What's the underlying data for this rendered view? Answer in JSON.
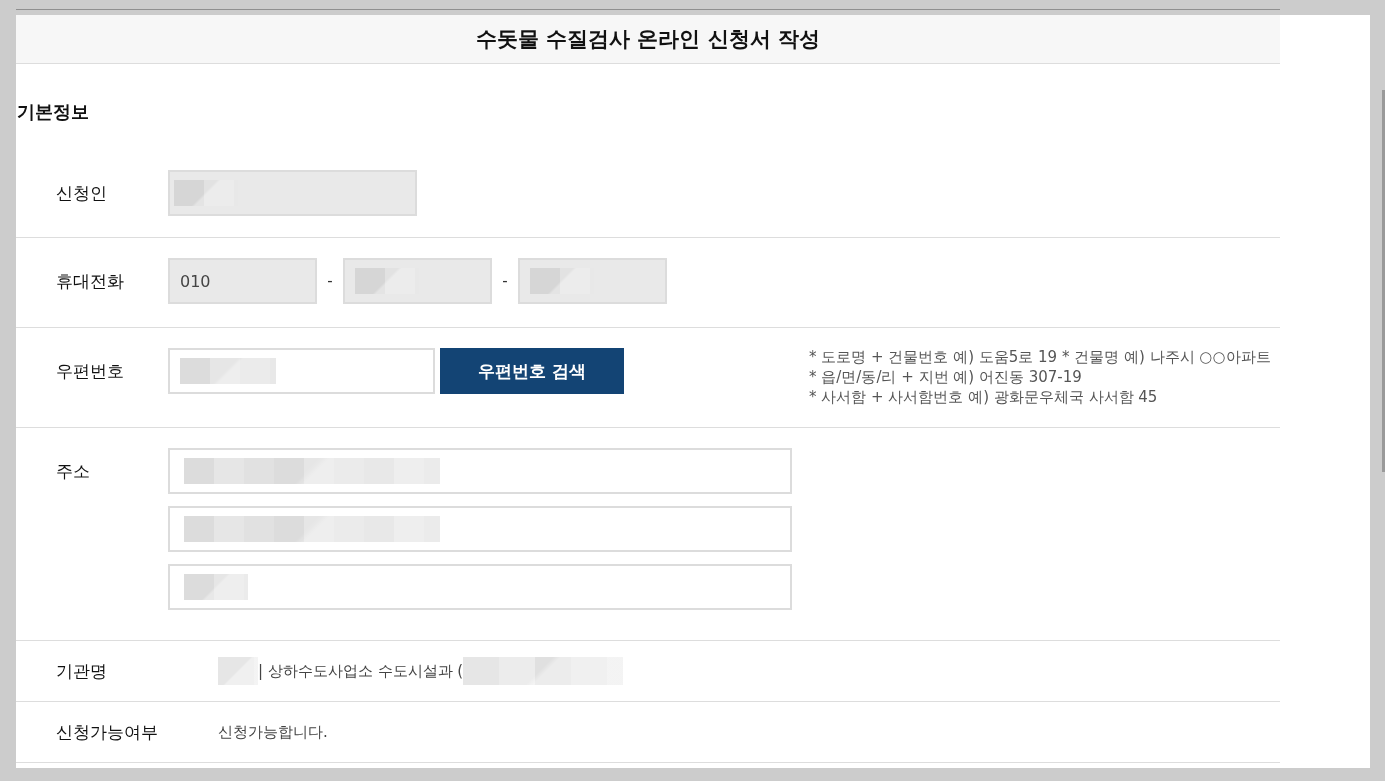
{
  "title": "수돗물 수질검사 온라인 신청서 작성",
  "section": {
    "heading": "기본정보",
    "rows": [
      {
        "kind": "single",
        "label": "신청인",
        "fields": [
          {
            "readonly": true,
            "redacted": true
          }
        ]
      },
      {
        "kind": "phone",
        "label": "휴대전화",
        "fields": [
          {
            "readonly": true,
            "redacted": false,
            "value": "010"
          },
          {
            "readonly": true,
            "redacted": true
          },
          {
            "readonly": true,
            "redacted": true
          }
        ],
        "separators": [
          "-",
          "-"
        ]
      },
      {
        "kind": "zipcode",
        "label": "우편번호",
        "fields": [
          {
            "readonly": false,
            "redacted": true
          }
        ],
        "button": "우편번호 검색",
        "notes": [
          "* 도로명 + 건물번호 예) 도움5로 19 * 건물명 예) 나주시 ○○아파트",
          "* 읍/면/동/리 + 지번 예) 어진동 307-19",
          "* 사서함 + 사서함번호 예) 광화문우체국 사서함 45"
        ]
      },
      {
        "kind": "address",
        "label": "주소",
        "fields": [
          {
            "readonly": false,
            "redacted": true
          },
          {
            "readonly": false,
            "redacted": true
          },
          {
            "readonly": false,
            "redacted": true
          }
        ]
      },
      {
        "kind": "text",
        "label": "기관명",
        "segments": [
          {
            "kind": "masked"
          },
          {
            "kind": "text",
            "text": "| 상하수도사업소 수도시설과 ("
          },
          {
            "kind": "masked"
          }
        ]
      },
      {
        "kind": "text",
        "label": "신청가능여부",
        "segments": [
          {
            "kind": "text",
            "text": "신청가능합니다."
          }
        ]
      }
    ]
  }
}
